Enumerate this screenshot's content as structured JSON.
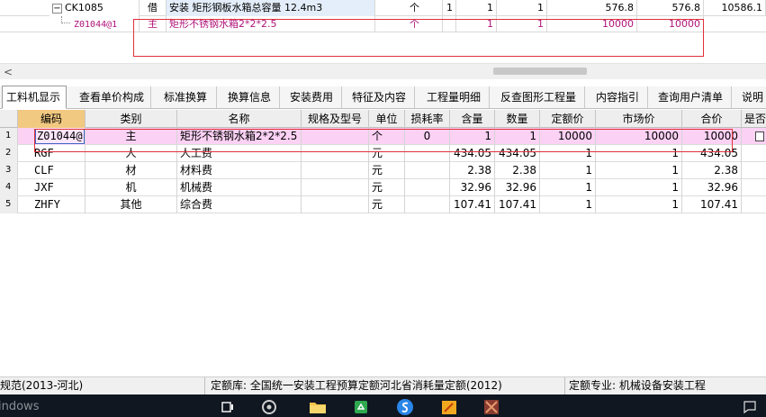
{
  "top_grid": {
    "row1": {
      "expander": "−",
      "code": "CK1085",
      "type": "借",
      "name": "安装 矩形钢板水箱总容量 12.4m3",
      "unit": "个",
      "loss": "1",
      "content": "1",
      "qty": "1",
      "quota": "576.8",
      "market": "576.8",
      "total": "10586.1"
    },
    "row2": {
      "code": "Z01044@1",
      "type": "主",
      "name": "矩形不锈钢水箱2*2*2.5",
      "unit": "个",
      "content": "1",
      "qty": "1",
      "quota": "10000",
      "market": "10000"
    }
  },
  "scroll_arrow": "<",
  "tabs": [
    {
      "label": "工料机显示",
      "active": true
    },
    {
      "label": "查看单价构成"
    },
    {
      "label": "标准换算"
    },
    {
      "label": "换算信息"
    },
    {
      "label": "安装费用"
    },
    {
      "label": "特征及内容"
    },
    {
      "label": "工程量明细"
    },
    {
      "label": "反查图形工程量"
    },
    {
      "label": "内容指引"
    },
    {
      "label": "查询用户清单"
    },
    {
      "label": "说明"
    }
  ],
  "grid": {
    "headers": [
      "编码",
      "类别",
      "名称",
      "规格及型号",
      "单位",
      "损耗率",
      "含量",
      "数量",
      "定额价",
      "市场价",
      "合价",
      "是否"
    ],
    "rows": [
      {
        "no": "1",
        "code": "Z01044@1",
        "type": "主",
        "name": "矩形不锈钢水箱2*2*2.5",
        "spec": "",
        "unit": "个",
        "loss": "0",
        "content": "1",
        "qty": "1",
        "quota": "10000",
        "market": "10000",
        "total": "10000"
      },
      {
        "no": "2",
        "code": "RGF",
        "type": "人",
        "name": "人工费",
        "spec": "",
        "unit": "元",
        "loss": "",
        "content": "434.05",
        "qty": "434.05",
        "quota": "1",
        "market": "1",
        "total": "434.05"
      },
      {
        "no": "3",
        "code": "CLF",
        "type": "材",
        "name": "材料费",
        "spec": "",
        "unit": "元",
        "loss": "",
        "content": "2.38",
        "qty": "2.38",
        "quota": "1",
        "market": "1",
        "total": "2.38"
      },
      {
        "no": "4",
        "code": "JXF",
        "type": "机",
        "name": "机械费",
        "spec": "",
        "unit": "元",
        "loss": "",
        "content": "32.96",
        "qty": "32.96",
        "quota": "1",
        "market": "1",
        "total": "32.96"
      },
      {
        "no": "5",
        "code": "ZHFY",
        "type": "其他",
        "name": "综合费",
        "spec": "",
        "unit": "元",
        "loss": "",
        "content": "107.41",
        "qty": "107.41",
        "quota": "1",
        "market": "1",
        "total": "107.41"
      }
    ]
  },
  "status_bar": {
    "spec": "规范(2013-河北)",
    "library": "定额库: 全国统一安装工程预算定额河北省消耗量定额(2012)",
    "major": "定额专业: 机械设备安装工程"
  },
  "taskbar": {
    "windows_text": "indows",
    "icons": [
      "task-view-icon",
      "chrome-like-icon",
      "folder-icon",
      "recycle-icon",
      "sogou-icon",
      "notes-icon",
      "app-icon",
      "notification-icon"
    ]
  },
  "colors": {
    "selected_row": "#fbd1f4",
    "header_selected": "#f2c981",
    "annotation_box": "#e0303a",
    "child_row_text": "#b0127a"
  }
}
